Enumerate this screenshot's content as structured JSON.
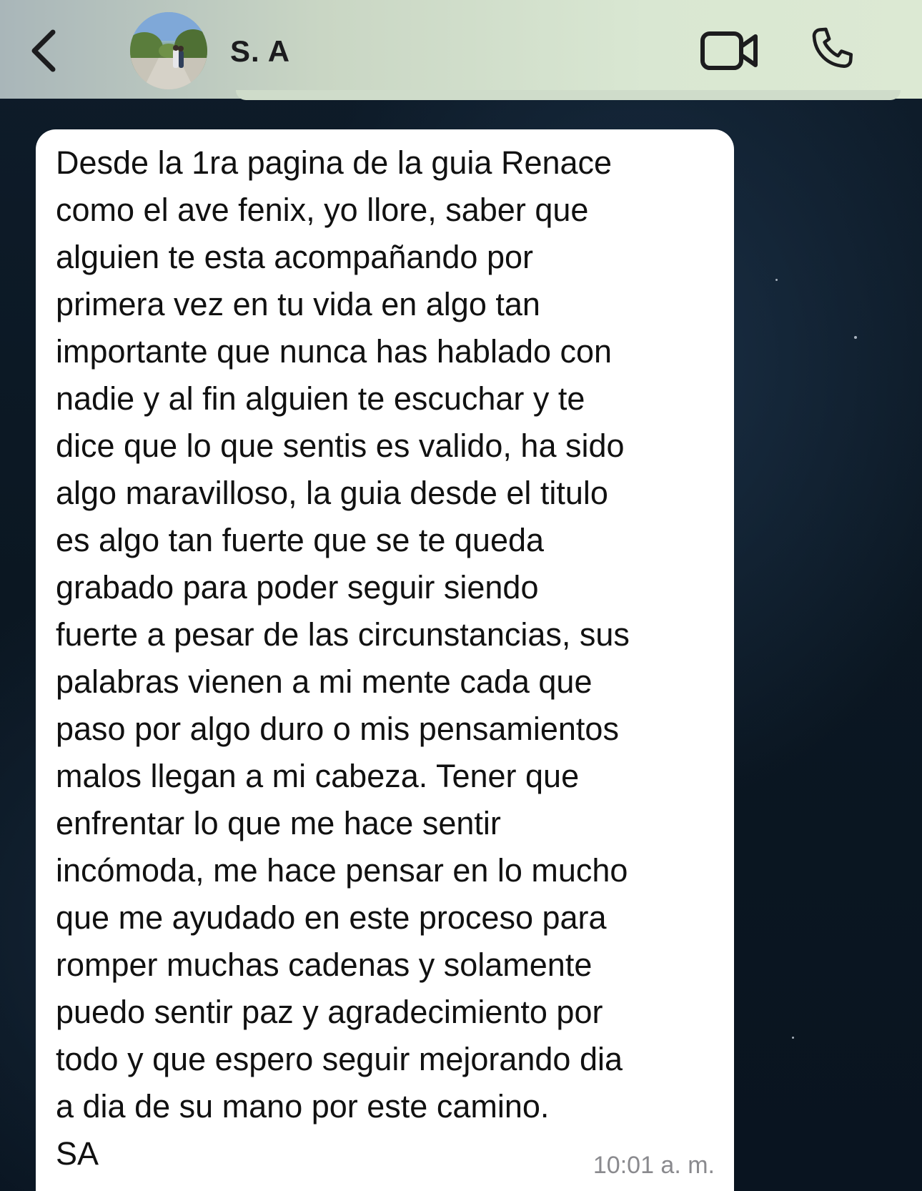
{
  "header": {
    "contact_name": "S. A",
    "icons": {
      "back": "chevron-left-icon",
      "video": "video-camera-icon",
      "call": "phone-icon"
    }
  },
  "message": {
    "text": "Desde la 1ra pagina de la guia Renace\ncomo el ave fenix, yo llore, saber que\nalguien te esta acompañando por\nprimera vez en tu vida en algo tan\nimportante que nunca has hablado con\nnadie y al fin alguien te escuchar y te\ndice que lo que sentis es valido, ha sido\nalgo maravilloso, la guia desde el titulo\nes algo tan fuerte que se te queda\ngrabado para poder seguir siendo\nfuerte a pesar de las circunstancias, sus\npalabras vienen a mi mente cada que\npaso por algo duro o mis pensamientos\nmalos llegan a mi cabeza. Tener que\nenfrentar lo que me hace sentir\nincómoda, me hace pensar en lo mucho\nque me ayudado en este proceso para\nromper muchas cadenas y solamente\npuedo sentir paz y agradecimiento por\ntodo y que espero seguir mejorando dia\na dia de su mano por este camino.\nSA",
    "time": "10:01 a. m."
  },
  "colors": {
    "header_start": "#a9b6b9",
    "header_end": "#dce9d3",
    "bubble": "#ffffff",
    "wallpaper": "#0d1a26",
    "timestamp": "#8a8a8e"
  }
}
